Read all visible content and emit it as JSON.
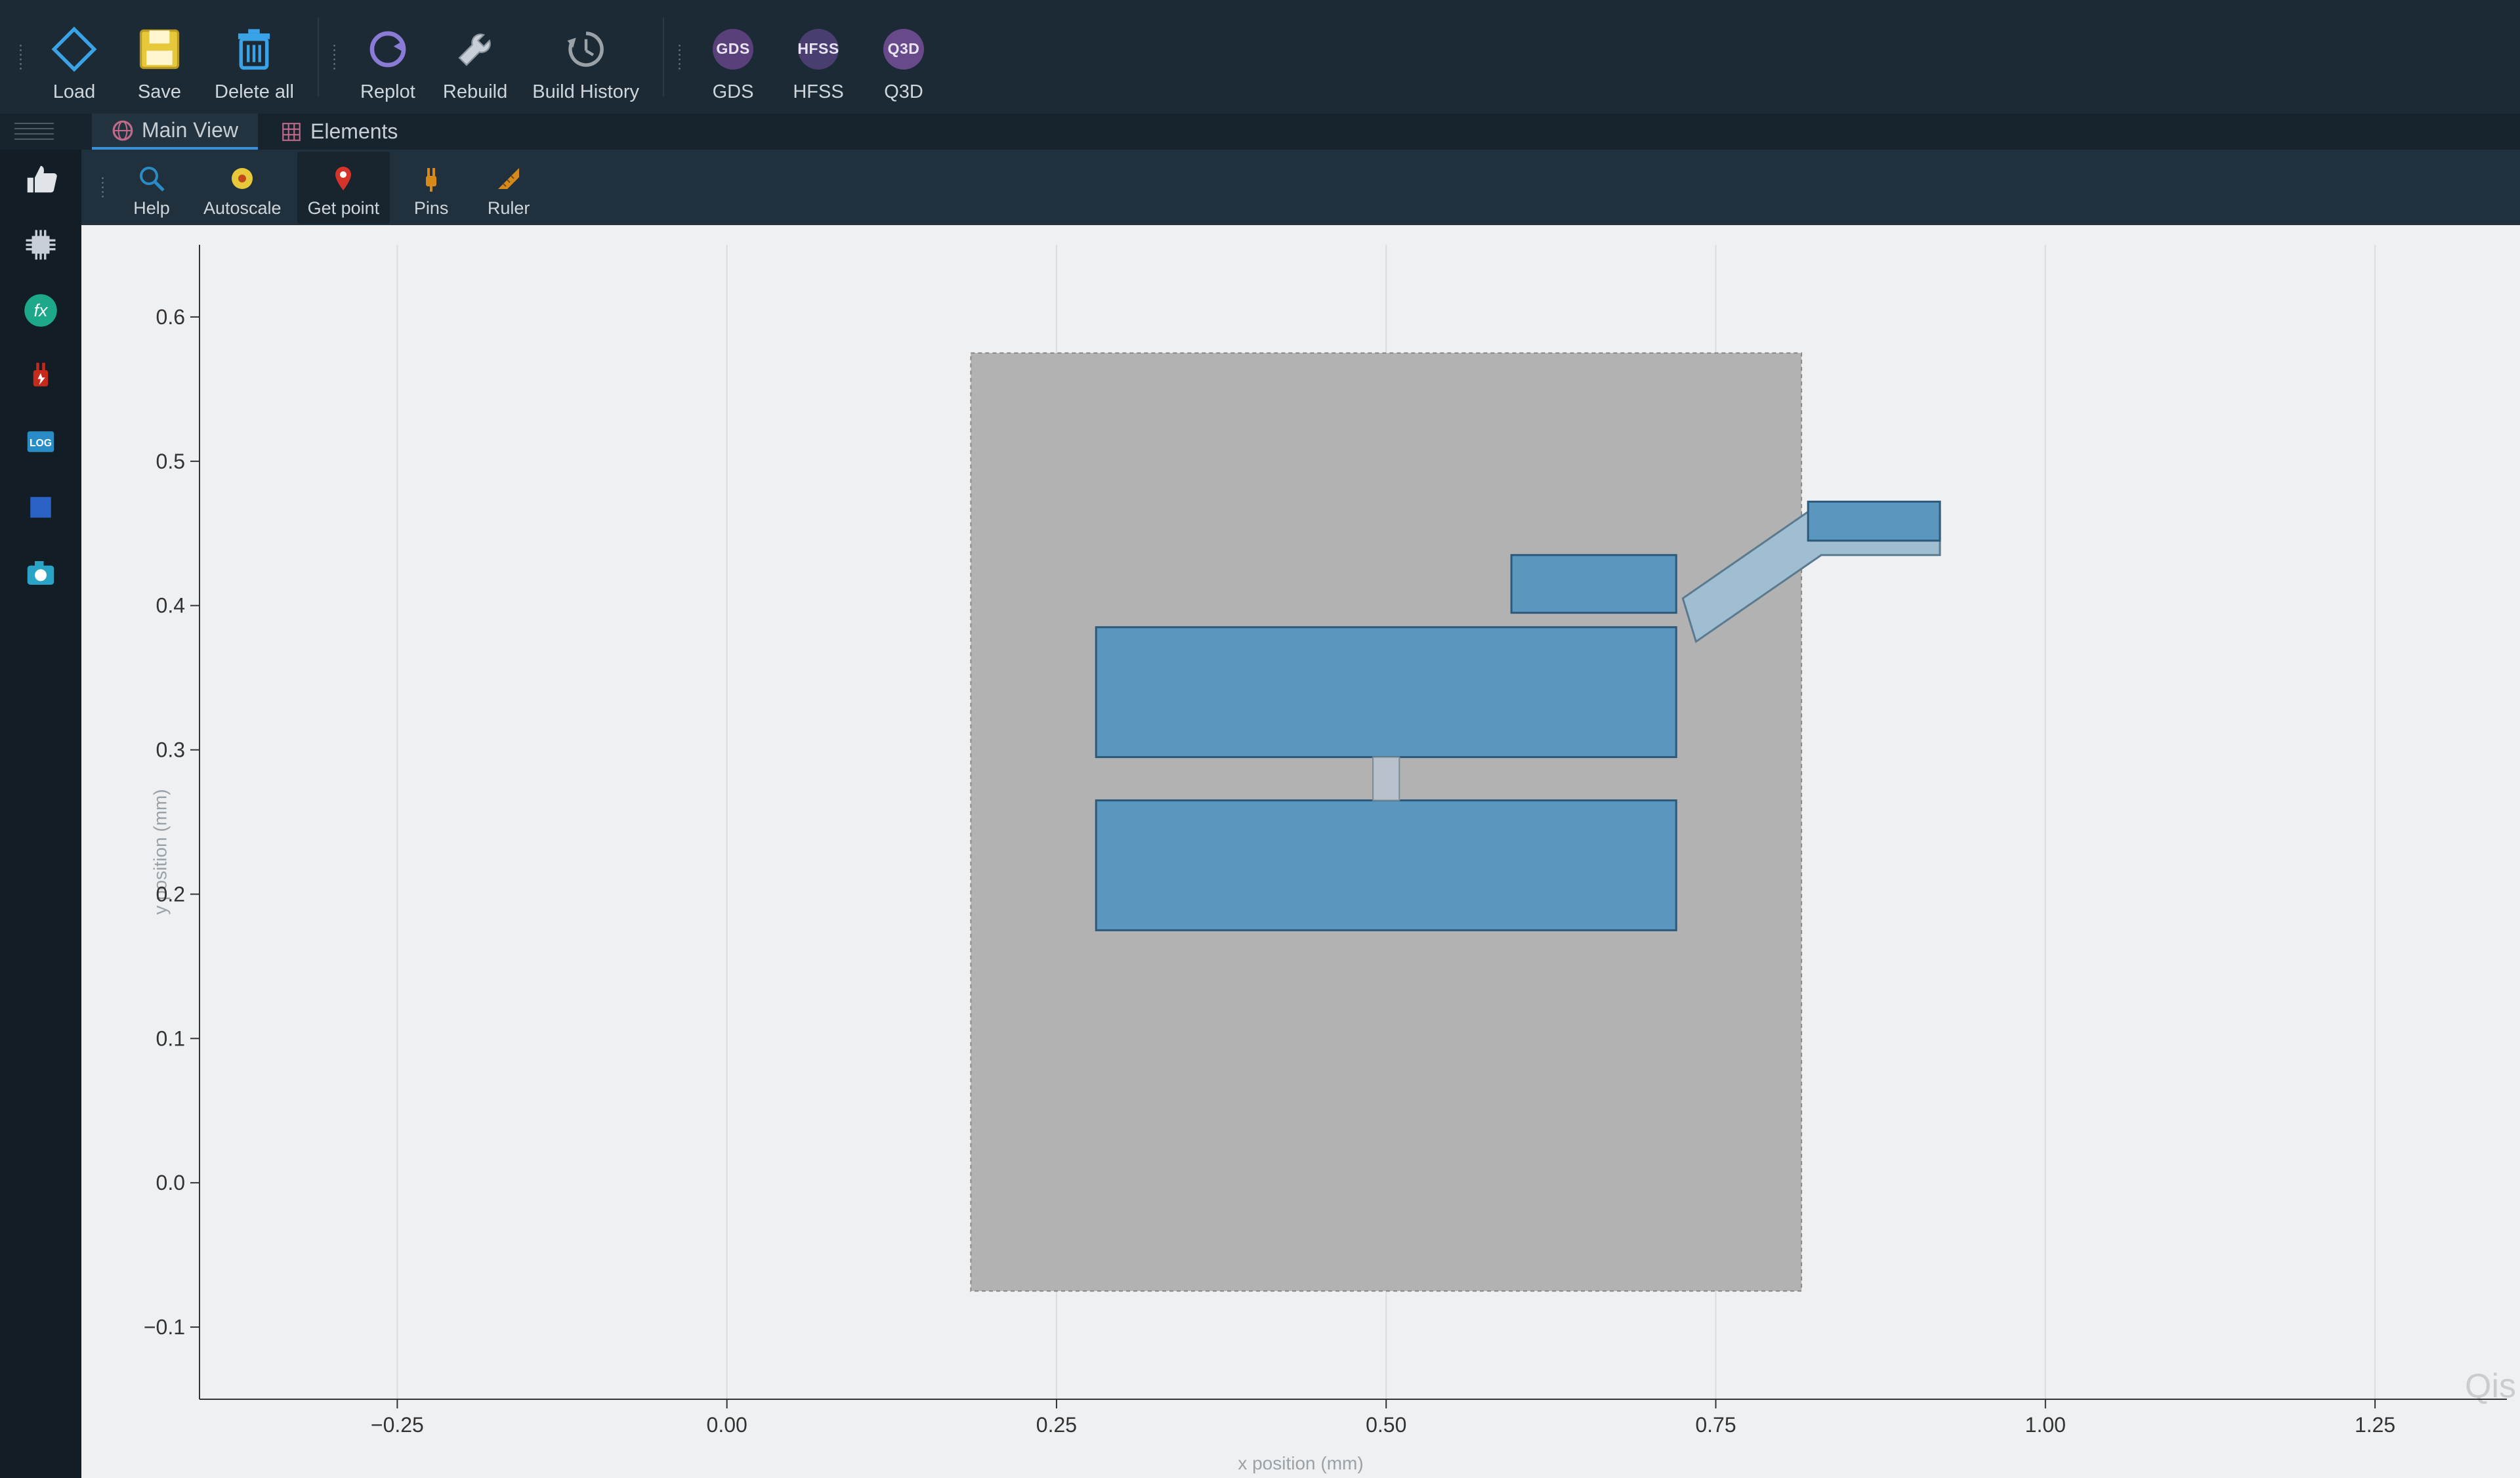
{
  "toolbar": {
    "load": "Load",
    "save": "Save",
    "delete_all": "Delete all",
    "replot": "Replot",
    "rebuild": "Rebuild",
    "build_history": "Build History",
    "gds": "GDS",
    "hfss": "HFSS",
    "q3d": "Q3D",
    "gds_badge": "GDS",
    "hfss_badge": "HFSS",
    "q3d_badge": "Q3D"
  },
  "tabs": {
    "main_view": "Main View",
    "elements": "Elements"
  },
  "sec": {
    "help": "Help",
    "autoscale": "Autoscale",
    "get_point": "Get point",
    "pins": "Pins",
    "ruler": "Ruler"
  },
  "axes": {
    "xlabel": "x position (mm)",
    "ylabel": "y position (mm)"
  },
  "watermark": "Qis",
  "chart_data": {
    "type": "scatter",
    "xlabel": "x position (mm)",
    "ylabel": "y position (mm)",
    "xlim": [
      -0.4,
      1.35
    ],
    "ylim": [
      -0.15,
      0.65
    ],
    "xticks": [
      -0.25,
      0.0,
      0.25,
      0.5,
      0.75,
      1.0,
      1.25
    ],
    "yticks": [
      -0.1,
      0.0,
      0.1,
      0.2,
      0.3,
      0.4,
      0.5,
      0.6
    ],
    "shapes": [
      {
        "name": "chip_outline",
        "kind": "rect",
        "x0": 0.185,
        "y0": -0.075,
        "x1": 0.815,
        "y1": 0.575,
        "style": "chip"
      },
      {
        "name": "upper_pad",
        "kind": "rect",
        "x0": 0.28,
        "y0": 0.295,
        "x1": 0.72,
        "y1": 0.385,
        "style": "pad"
      },
      {
        "name": "lower_pad",
        "kind": "rect",
        "x0": 0.28,
        "y0": 0.175,
        "x1": 0.72,
        "y1": 0.265,
        "style": "pad"
      },
      {
        "name": "junction",
        "kind": "rect",
        "x0": 0.49,
        "y0": 0.265,
        "x1": 0.51,
        "y1": 0.295,
        "style": "junction"
      },
      {
        "name": "connector_pad",
        "kind": "rect",
        "x0": 0.595,
        "y0": 0.395,
        "x1": 0.72,
        "y1": 0.435,
        "style": "pad"
      },
      {
        "name": "trace_diag",
        "kind": "poly",
        "points": [
          [
            0.725,
            0.405
          ],
          [
            0.82,
            0.465
          ],
          [
            0.92,
            0.465
          ],
          [
            0.92,
            0.435
          ],
          [
            0.83,
            0.435
          ],
          [
            0.735,
            0.375
          ]
        ],
        "style": "trace"
      },
      {
        "name": "trace_end_pad",
        "kind": "rect",
        "x0": 0.82,
        "y0": 0.445,
        "x1": 0.92,
        "y1": 0.472,
        "style": "pad"
      }
    ]
  }
}
